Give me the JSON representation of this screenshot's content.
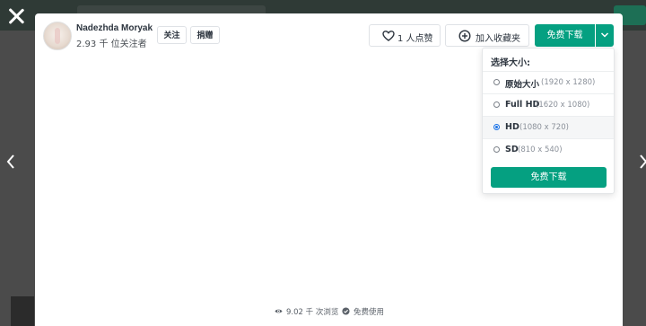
{
  "author": {
    "name": "Nadezhda Moryak",
    "followers": "2.93 千 位关注者",
    "follow_label": "关注",
    "donate_label": "捐赠"
  },
  "actions": {
    "like_label": "1 人点赞",
    "collect_label": "加入收藏夹",
    "download_label": "免费下载"
  },
  "size_menu": {
    "title": "选择大小:",
    "options": [
      {
        "name": "原始大小",
        "dims": "(1920 x 1280)",
        "selected": false
      },
      {
        "name": "Full HD",
        "dims": "(1620 x 1080)",
        "selected": false
      },
      {
        "name": "HD",
        "dims": "(1080 x 720)",
        "selected": true
      },
      {
        "name": "SD",
        "dims": "(810 x 540)",
        "selected": false
      }
    ],
    "download_label": "免费下载"
  },
  "footer": {
    "views": "9.02 千 次浏览",
    "license": "免费使用"
  },
  "colors": {
    "accent": "#05a081",
    "radio_selected": "#1a73e8",
    "overlay": "#4b4b4b"
  },
  "icons": [
    "close-icon",
    "chevron-left-icon",
    "chevron-right-icon",
    "heart-icon",
    "plus-circle-icon",
    "chevron-down-icon",
    "eye-icon",
    "check-circle-icon"
  ]
}
